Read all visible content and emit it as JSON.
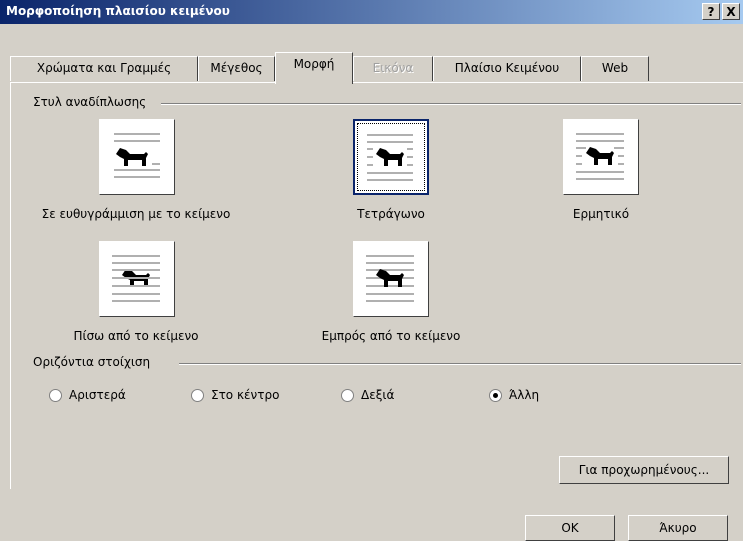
{
  "window": {
    "title": "Μορφοποίηση πλαισίου κειμένου",
    "help_glyph": "?",
    "close_glyph": "X"
  },
  "tabs": [
    {
      "label": "Χρώματα και Γραμμές"
    },
    {
      "label": "Μέγεθος"
    },
    {
      "label": "Μορφή"
    },
    {
      "label": "Εικόνα"
    },
    {
      "label": "Πλαίσιο Κειμένου"
    },
    {
      "label": "Web"
    }
  ],
  "wrap_group": {
    "label": "Στυλ αναδίπλωσης",
    "options": [
      {
        "label": "Σε ευθυγράμμιση με το κείμενο",
        "icon": "inline-wrap-icon"
      },
      {
        "label": "Τετράγωνο",
        "icon": "square-wrap-icon",
        "selected": true
      },
      {
        "label": "Ερμητικό",
        "icon": "tight-wrap-icon"
      },
      {
        "label": "Πίσω από το κείμενο",
        "icon": "behind-text-icon"
      },
      {
        "label": "Εμπρός από το κείμενο",
        "icon": "in-front-text-icon"
      }
    ]
  },
  "align_group": {
    "label": "Οριζόντια στοίχιση",
    "options": [
      {
        "label": "Αριστερά",
        "checked": false
      },
      {
        "label": "Στο κέντρο",
        "checked": false
      },
      {
        "label": "Δεξιά",
        "checked": false
      },
      {
        "label": "Άλλη",
        "checked": true
      }
    ]
  },
  "buttons": {
    "advanced": "Για προχωρημένους...",
    "ok": "OK",
    "cancel": "Άκυρο"
  },
  "colors": {
    "title_start": "#0a246a",
    "title_end": "#a6caf0",
    "face": "#d4d0c8"
  }
}
